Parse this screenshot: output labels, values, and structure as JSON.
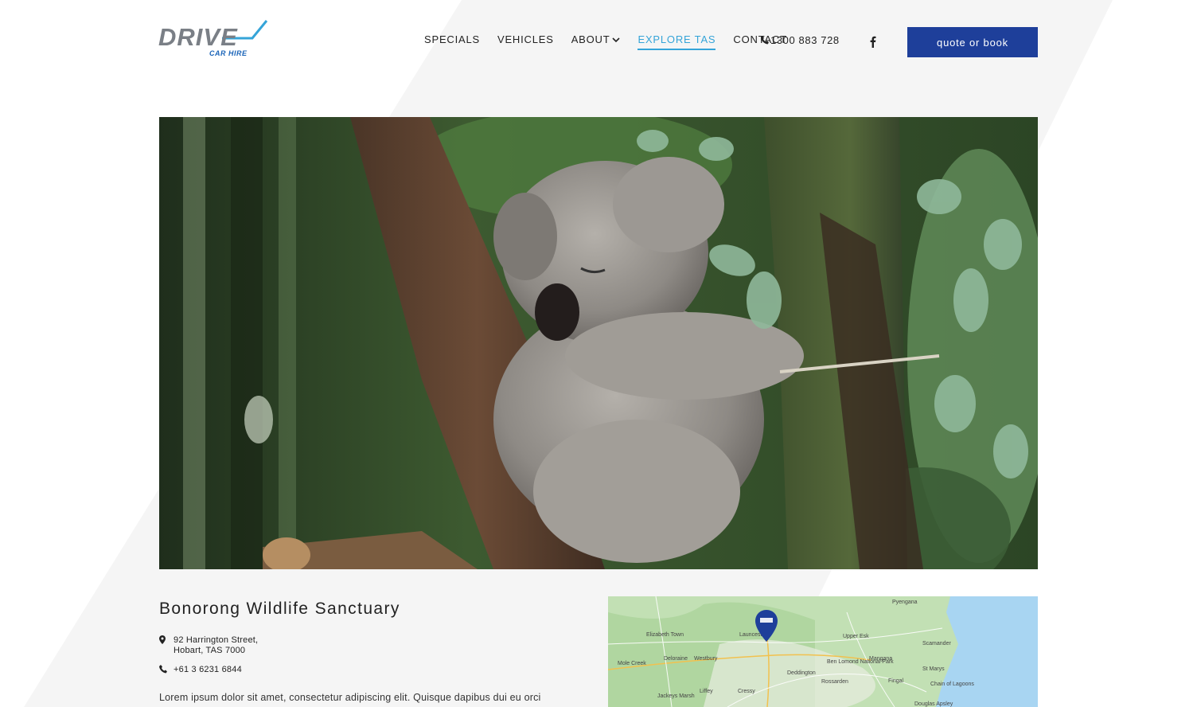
{
  "brand": {
    "logo_word": "DRIVE",
    "logo_sub": "CAR HIRE",
    "colors": {
      "navy": "#1e3f9a",
      "accent": "#35a4d8",
      "logo_grey": "#7a7f86"
    }
  },
  "nav": {
    "items": [
      {
        "label": "SPECIALS"
      },
      {
        "label": "VEHICLES"
      },
      {
        "label": "ABOUT",
        "has_dropdown": true
      },
      {
        "label": "EXPLORE TAS",
        "active": true
      },
      {
        "label": "CONTACT"
      }
    ],
    "phone": "1300 883 728",
    "social_icon": "facebook-icon",
    "cta_label": "quote or book"
  },
  "hero": {
    "image_subject": "koala sleeping in eucalyptus tree"
  },
  "listing": {
    "title": "Bonorong Wildlife Sanctuary",
    "address_line1": "92 Harrington Street,",
    "address_line2": "Hobart, TAS 7000",
    "phone": "+61 3 6231 6844",
    "description": "Lorem ipsum dolor sit amet, consectetur adipiscing elit. Quisque dapibus dui eu orci"
  },
  "map": {
    "labels": [
      "Pyengana",
      "Elizabeth Town",
      "Launceston",
      "Upper Esk",
      "Scamander",
      "Mole Creek",
      "Deloraine",
      "Westbury",
      "Ben Lomond National Park",
      "Mangana",
      "St Marys",
      "Deddington",
      "Rossarden",
      "Fingal",
      "Chain of Lagoons",
      "Liffey",
      "Cressy",
      "Jackeys Marsh",
      "Douglas Apsley"
    ],
    "marker_icon": "map-pin-icon"
  }
}
